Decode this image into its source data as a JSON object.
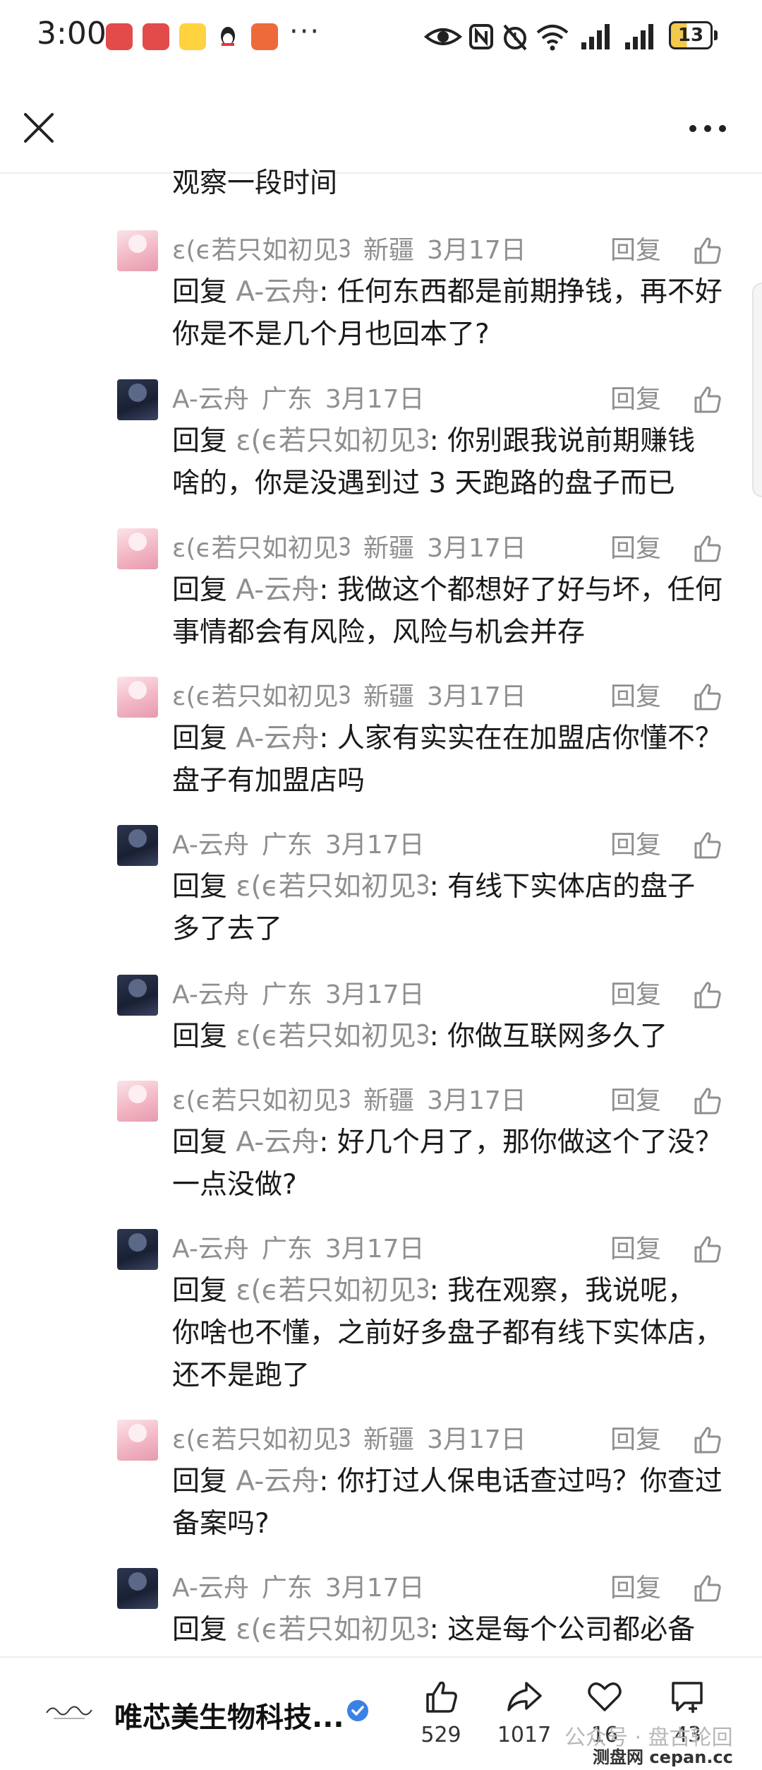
{
  "status_bar": {
    "time": "3:00",
    "more_notifications": "···",
    "battery": "13"
  },
  "header": {
    "close_icon": "close-icon",
    "more_icon": "more-horizontal-icon"
  },
  "partial_top_text": "观察一段时间",
  "reply_label": "回复",
  "comments": [
    {
      "avatar": "pink",
      "user": "ε(ϵ若只如初见ᢃ",
      "region": "新疆",
      "date": "3月17日",
      "prefix": "回复",
      "target": "A-云舟",
      "text": ": 任何东西都是前期挣钱，再不好你是不是几个月也回本了?"
    },
    {
      "avatar": "dark",
      "user": "A-云舟",
      "region": "广东",
      "date": "3月17日",
      "prefix": "回复",
      "target": "ε(ϵ若只如初见ᢃ",
      "text": ": 你别跟我说前期赚钱啥的，你是没遇到过 3 天跑路的盘子而已"
    },
    {
      "avatar": "pink",
      "user": "ε(ϵ若只如初见ᢃ",
      "region": "新疆",
      "date": "3月17日",
      "prefix": "回复",
      "target": "A-云舟",
      "text": ": 我做这个都想好了好与坏，任何事情都会有风险，风险与机会并存"
    },
    {
      "avatar": "pink",
      "user": "ε(ϵ若只如初见ᢃ",
      "region": "新疆",
      "date": "3月17日",
      "prefix": "回复",
      "target": "A-云舟",
      "text": ": 人家有实实在在加盟店你懂不？盘子有加盟店吗"
    },
    {
      "avatar": "dark",
      "user": "A-云舟",
      "region": "广东",
      "date": "3月17日",
      "prefix": "回复",
      "target": "ε(ϵ若只如初见ᢃ",
      "text": ": 有线下实体店的盘子多了去了"
    },
    {
      "avatar": "dark",
      "user": "A-云舟",
      "region": "广东",
      "date": "3月17日",
      "prefix": "回复",
      "target": "ε(ϵ若只如初见ᢃ",
      "text": ": 你做互联网多久了"
    },
    {
      "avatar": "pink",
      "user": "ε(ϵ若只如初见ᢃ",
      "region": "新疆",
      "date": "3月17日",
      "prefix": "回复",
      "target": "A-云舟",
      "text": ": 好几个月了，那你做这个了没？一点没做?"
    },
    {
      "avatar": "dark",
      "user": "A-云舟",
      "region": "广东",
      "date": "3月17日",
      "prefix": "回复",
      "target": "ε(ϵ若只如初见ᢃ",
      "text": ": 我在观察，我说呢，你啥也不懂，之前好多盘子都有线下实体店，还不是跑了"
    },
    {
      "avatar": "pink",
      "user": "ε(ϵ若只如初见ᢃ",
      "region": "新疆",
      "date": "3月17日",
      "prefix": "回复",
      "target": "A-云舟",
      "text": ": 你打过人保电话查过吗？你查过备案吗?"
    },
    {
      "avatar": "dark",
      "user": "A-云舟",
      "region": "广东",
      "date": "3月17日",
      "prefix": "回复",
      "target": "ε(ϵ若只如初见ᢃ",
      "text": ": 这是每个公司都必备"
    }
  ],
  "bottom_bar": {
    "account_name": "唯芯美生物科技...",
    "like_count": "529",
    "share_count": "1017",
    "favorite_count": "16",
    "comment_count": "43"
  },
  "watermark": {
    "text": "公众号 · 盘古轮回",
    "site": "测盘网 cepan.cc"
  }
}
